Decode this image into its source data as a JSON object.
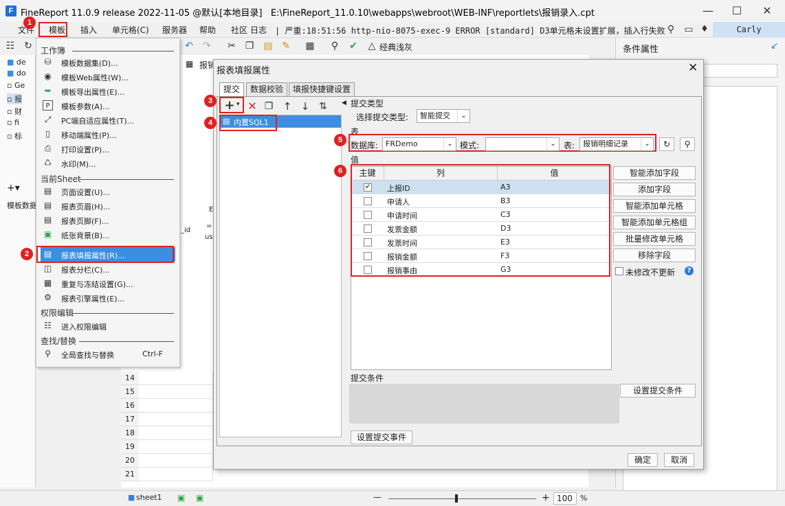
{
  "title_bar": {
    "app_title": "FineReport 11.0.9 release 2022-11-05 @默认[本地目录]",
    "path": "E:\\FineReport_11.0.10\\webapps\\webroot\\WEB-INF\\reportlets\\报销录入.cpt",
    "logo_letter": "F"
  },
  "menu": {
    "items": [
      "文件",
      "模板",
      "插入",
      "单元格(C)",
      "服务器",
      "帮助",
      "社区",
      "日志"
    ],
    "log_text": "| 严重:18:51:56 http-nio-8075-exec-9 ERROR [standard] D3单元格未设置扩展，插入行失败",
    "user": "Carly"
  },
  "toolbar": {
    "theme_label": "经典浅灰"
  },
  "left_panel": {
    "rows": [
      "de",
      "do",
      "Ge",
      "报",
      "财",
      "fi",
      "标"
    ],
    "bottom_label": "模板数据"
  },
  "sheet": {
    "tab_label": "报销",
    "row_numbers": [
      "14",
      "15",
      "16",
      "17",
      "18",
      "19",
      "20",
      "21"
    ],
    "cell_snippets": [
      "E",
      "_id",
      "=",
      "us"
    ],
    "sheet_name": "sheet1",
    "zoom": "100",
    "zoom_unit": "%"
  },
  "right_panel": {
    "title": "条件属性"
  },
  "dropdown": {
    "sections": [
      {
        "title": "工作簿",
        "items": [
          {
            "label": "模板数据集(D)...",
            "icon": "database-icon"
          },
          {
            "label": "模板Web属性(W)...",
            "icon": "globe-icon"
          },
          {
            "label": "模板导出属性(E)...",
            "icon": "export-icon"
          },
          {
            "label": "模板参数(A)...",
            "icon": "param-icon"
          },
          {
            "label": "PC端自适应属性(T)...",
            "icon": "expand-icon"
          },
          {
            "label": "移动端属性(P)...",
            "icon": "mobile-icon"
          },
          {
            "label": "打印设置(P)...",
            "icon": "printer-icon"
          },
          {
            "label": "水印(M)...",
            "icon": "stamp-icon"
          }
        ]
      },
      {
        "title": "当前Sheet",
        "items": [
          {
            "label": "页面设置(U)...",
            "icon": "page-icon"
          },
          {
            "label": "报表页眉(H)...",
            "icon": "header-icon"
          },
          {
            "label": "报表页脚(F)...",
            "icon": "footer-icon"
          },
          {
            "label": "纸张背景(B)...",
            "icon": "image-icon"
          },
          {
            "label": "报表填报属性(R)...",
            "icon": "form-icon"
          },
          {
            "label": "报表分栏(C)...",
            "icon": "columns-icon"
          },
          {
            "label": "重复与冻结设置(G)...",
            "icon": "freeze-icon"
          },
          {
            "label": "报表引擎属性(E)...",
            "icon": "engine-icon"
          }
        ]
      },
      {
        "title": "权限编辑",
        "items": [
          {
            "label": "进入权限编辑",
            "icon": "permission-icon"
          }
        ]
      },
      {
        "title": "查找/替换",
        "items": [
          {
            "label": "全局查找与替换",
            "icon": "search-icon",
            "shortcut": "Ctrl-F"
          }
        ]
      }
    ]
  },
  "dialog": {
    "title": "报表填报属性",
    "tabs": [
      "提交",
      "数据校验",
      "填报快捷键设置"
    ],
    "sql_item": "内置SQL1",
    "submit_type_section": "提交类型",
    "select_type_label": "选择提交类型:",
    "select_type_value": "智能提交",
    "table_section": "表",
    "db_label": "数据库:",
    "db_value": "FRDemo",
    "mode_label": "模式:",
    "mode_value": "",
    "table_label": "表:",
    "table_value": "报销明细记录",
    "value_section": "值",
    "columns": [
      "主键",
      "列",
      "值"
    ],
    "rows": [
      {
        "checked": true,
        "col": "上报ID",
        "val": "A3"
      },
      {
        "checked": false,
        "col": "申请人",
        "val": "B3"
      },
      {
        "checked": false,
        "col": "申请时间",
        "val": "C3"
      },
      {
        "checked": false,
        "col": "发票金额",
        "val": "D3"
      },
      {
        "checked": false,
        "col": "发票时间",
        "val": "E3"
      },
      {
        "checked": false,
        "col": "报销金额",
        "val": "F3"
      },
      {
        "checked": false,
        "col": "报销事由",
        "val": "G3"
      }
    ],
    "side_buttons": [
      "智能添加字段",
      "添加字段",
      "智能添加单元格",
      "智能添加单元格组",
      "批量修改单元格",
      "移除字段"
    ],
    "no_update_label": "未修改不更新",
    "submit_condition_label": "提交条件",
    "set_condition_button": "设置提交条件",
    "set_event_button": "设置提交事件",
    "ok": "确定",
    "cancel": "取消"
  },
  "badges": [
    "1",
    "2",
    "3",
    "4",
    "5",
    "6"
  ],
  "colors": {
    "accent": "#3d8ee0",
    "annotation": "#e02020",
    "user_bg": "#cfe2f5"
  }
}
